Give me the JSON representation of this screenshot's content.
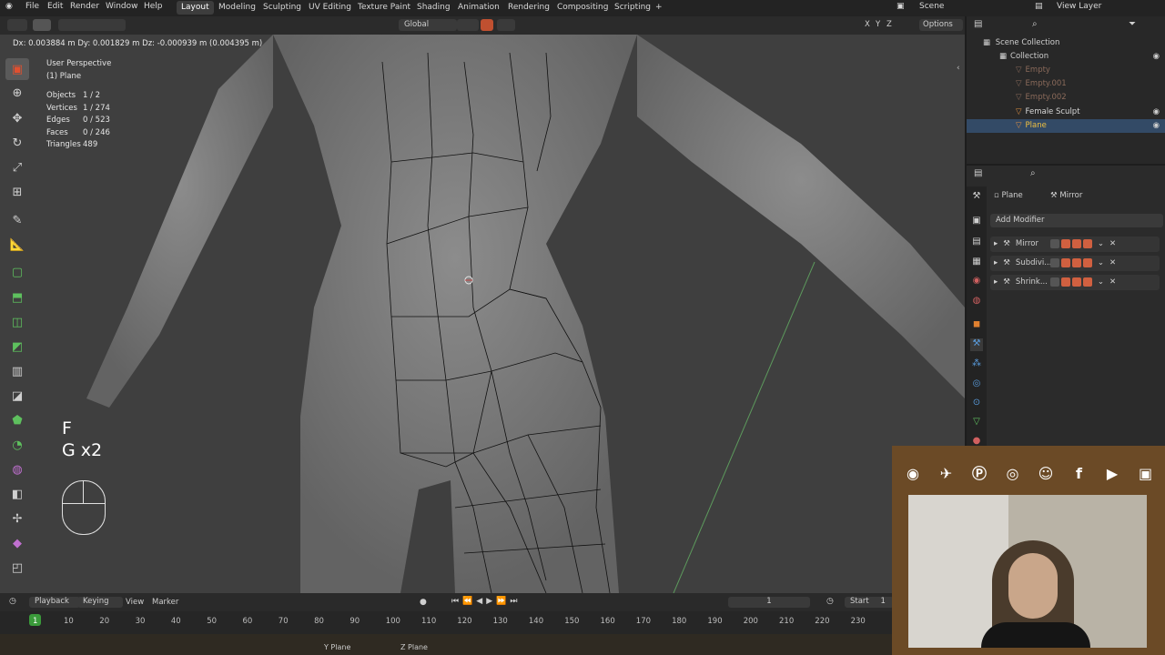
{
  "topbar": {
    "menus": [
      "File",
      "Edit",
      "Render",
      "Window",
      "Help"
    ],
    "workspaces": [
      "Layout",
      "Modeling",
      "Sculpting",
      "UV Editing",
      "Texture Paint",
      "Shading",
      "Animation",
      "Rendering",
      "Compositing",
      "Scripting"
    ],
    "active_workspace": "Layout",
    "add_tab": "+",
    "scene_label": "Scene",
    "view_layer_label": "View Layer"
  },
  "header2": {
    "status": "Dx: 0.003884 m  Dy: 0.001829 m  Dz: -0.000939 m (0.004395 m)",
    "orientation": "Global",
    "axes": [
      "X",
      "Y",
      "Z"
    ],
    "options": "Options"
  },
  "viewport": {
    "view_name": "User Perspective",
    "object_name": "(1) Plane",
    "stats": [
      {
        "label": "Objects",
        "value": "1 / 2"
      },
      {
        "label": "Vertices",
        "value": "1 / 274"
      },
      {
        "label": "Edges",
        "value": "0 / 523"
      },
      {
        "label": "Faces",
        "value": "0 / 246"
      },
      {
        "label": "Triangles",
        "value": "489"
      }
    ],
    "key_1": "F",
    "key_2": "G x2"
  },
  "outliner": {
    "title": "Scene Collection",
    "rows": [
      {
        "name": "Collection",
        "indent": 1,
        "dim": false,
        "color": "#cfcfcf"
      },
      {
        "name": "Empty",
        "indent": 2,
        "dim": true,
        "color": "#8a6a5a"
      },
      {
        "name": "Empty.001",
        "indent": 2,
        "dim": true,
        "color": "#8a6a5a"
      },
      {
        "name": "Empty.002",
        "indent": 2,
        "dim": true,
        "color": "#8a6a5a"
      },
      {
        "name": "Female Sculpt",
        "indent": 2,
        "dim": false,
        "color": "#d8d8d8"
      },
      {
        "name": "Plane",
        "indent": 2,
        "dim": false,
        "color": "#f0c040"
      }
    ]
  },
  "properties": {
    "object": "Plane",
    "modifier_context": "Mirror",
    "add_modifier": "Add Modifier",
    "modifiers": [
      "Mirror",
      "Subdivi...",
      "Shrink..."
    ]
  },
  "timeline": {
    "menus": [
      "Playback",
      "Keying",
      "View",
      "Marker"
    ],
    "current_frame": "1",
    "start_label": "Start",
    "start_value": "1",
    "ticks": [
      "1",
      "10",
      "20",
      "30",
      "40",
      "50",
      "60",
      "70",
      "80",
      "90",
      "100",
      "110",
      "120",
      "130",
      "140",
      "150",
      "160",
      "170",
      "180",
      "190",
      "200",
      "210",
      "220",
      "230"
    ]
  },
  "statusbar": {
    "hints": [
      "Y Plane",
      "Z Plane"
    ]
  },
  "social": {
    "icons": [
      "reddit-icon",
      "twitter-icon",
      "patreon-icon",
      "instagram-icon",
      "discord-icon",
      "facebook-icon",
      "youtube-icon",
      "twitch-icon"
    ],
    "accent": "#6b4a26"
  }
}
